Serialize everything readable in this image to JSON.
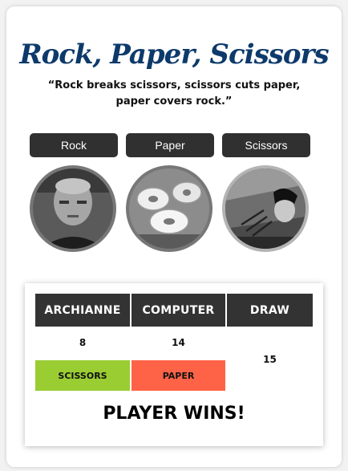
{
  "header": {
    "title": "Rock, Paper, Scissors",
    "quote": "“Rock breaks scissors, scissors cuts paper, paper covers rock.”"
  },
  "choices": [
    {
      "label": "Rock",
      "image_icon": "rock-photo"
    },
    {
      "label": "Paper",
      "image_icon": "paper-photo"
    },
    {
      "label": "Scissors",
      "image_icon": "scissors-photo"
    }
  ],
  "scoreboard": {
    "headers": {
      "player": "ARCHIANNE",
      "computer": "COMPUTER",
      "draw": "DRAW"
    },
    "scores": {
      "player": "8",
      "computer": "14",
      "draw": "15"
    },
    "picks": {
      "player": "SCISSORS",
      "computer": "PAPER"
    },
    "result": "PLAYER WINS!"
  },
  "colors": {
    "title": "#0d3a6b",
    "button_bg": "#303030",
    "player_pick": "#9acd32",
    "computer_pick": "#ff6347"
  }
}
